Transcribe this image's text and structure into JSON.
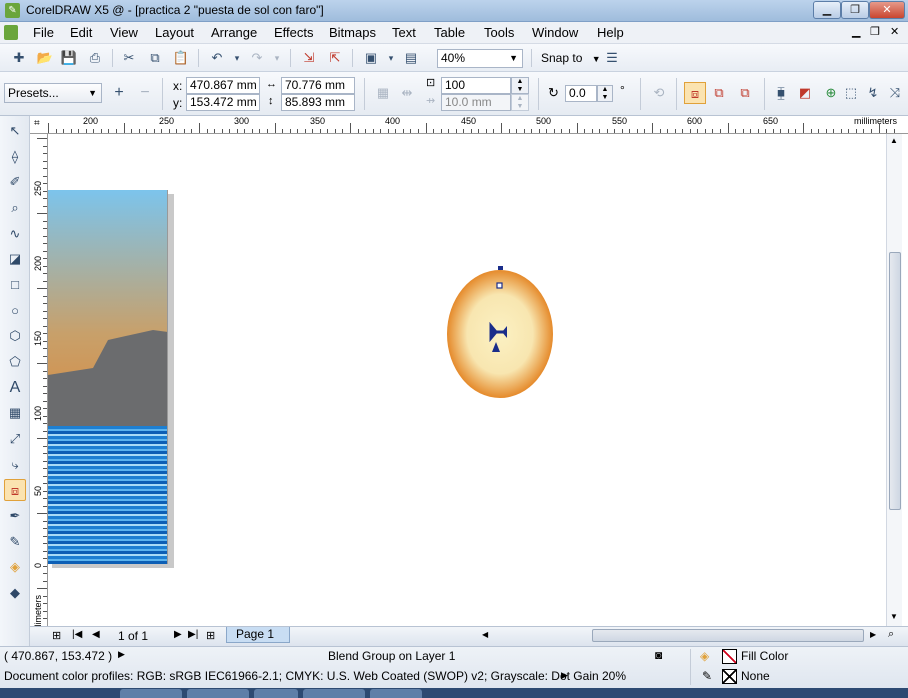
{
  "window": {
    "title": "CorelDRAW X5 @ - [practica 2 \"puesta de sol con faro\"]"
  },
  "menu": [
    "File",
    "Edit",
    "View",
    "Layout",
    "Arrange",
    "Effects",
    "Bitmaps",
    "Text",
    "Table",
    "Tools",
    "Window",
    "Help"
  ],
  "toolbar": {
    "zoom": "40%",
    "snap_to": "Snap to"
  },
  "property_bar": {
    "presets": "Presets...",
    "x_label": "x:",
    "x_value": "470.867 mm",
    "y_label": "y:",
    "y_value": "153.472 mm",
    "width_value": "70.776 mm",
    "height_value": "85.893 mm",
    "steps_value": "100",
    "offset_value": "10.0 mm",
    "angle_value": "0.0",
    "degree_symbol": "°"
  },
  "ruler": {
    "unit": "millimeters",
    "h_labels": [
      "200",
      "250",
      "300",
      "350",
      "400",
      "450",
      "500",
      "550",
      "600",
      "650"
    ],
    "v_labels": [
      "250",
      "200",
      "150",
      "100",
      "50",
      "0"
    ]
  },
  "page_nav": {
    "counter": "1 of 1",
    "page_tab": "Page 1"
  },
  "status": {
    "coordinates": "( 470.867, 153.472 )",
    "selection": "Blend Group on Layer 1",
    "color_profiles": "Document color profiles: RGB: sRGB IEC61966-2.1; CMYK: U.S. Web Coated (SWOP) v2; Grayscale: Dot Gain 20%",
    "fill_label": "Fill Color",
    "outline_label": "None"
  },
  "colors": {
    "sky_top": "#7cc4ec",
    "sky_bottom": "#d88a3f",
    "rock": "#6b6c6e",
    "sea": "#1d7fd2",
    "sun_outer": "#e58a2b",
    "sun_inner": "#fbf1c3",
    "accent": "#e0a13a"
  }
}
